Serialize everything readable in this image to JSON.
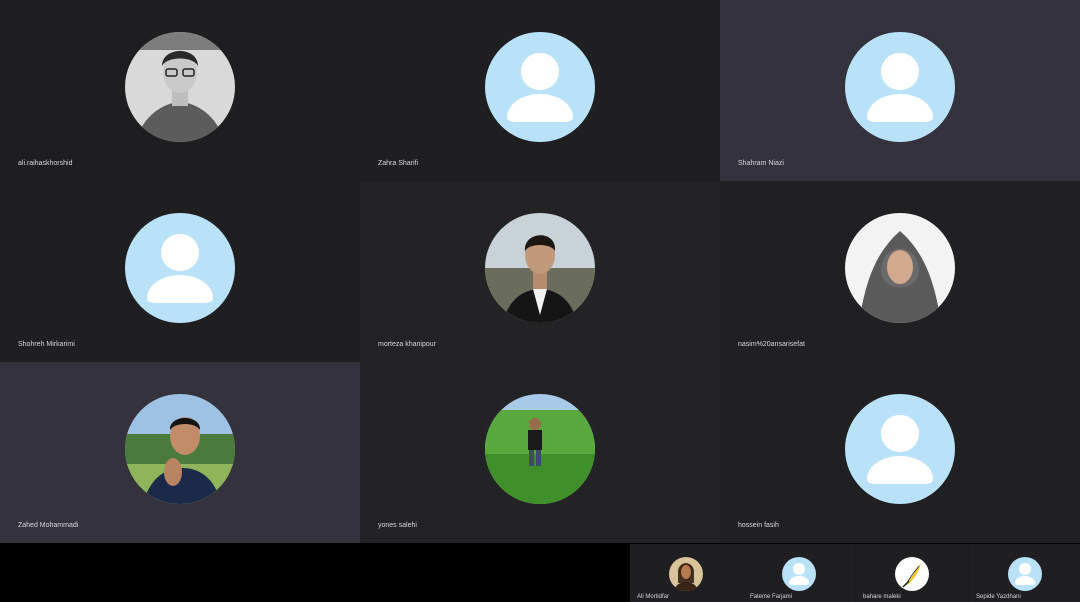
{
  "participants": [
    {
      "name": "ali.raihaskhorshid",
      "tile_color": "#1e1e21",
      "avatar": "photo-young-man-glasses"
    },
    {
      "name": "Zahra Sharifi",
      "tile_color": "#1f1f22",
      "avatar": "default-user-icon"
    },
    {
      "name": "Shahram Niazi",
      "tile_color": "#34333d",
      "avatar": "default-user-icon"
    },
    {
      "name": "Shohreh Mirkarimi",
      "tile_color": "#1f1f22",
      "avatar": "default-user-icon"
    },
    {
      "name": "morteza khanipour",
      "tile_color": "#232326",
      "avatar": "photo-man-suit"
    },
    {
      "name": "nasim%20ansarisefat",
      "tile_color": "#202023",
      "avatar": "photo-woman-hijab"
    },
    {
      "name": "Zahed Mohammadi",
      "tile_color": "#34333d",
      "avatar": "photo-man-outdoors"
    },
    {
      "name": "yones salehi",
      "tile_color": "#232326",
      "avatar": "photo-man-field"
    },
    {
      "name": "hossein fasih",
      "tile_color": "#202023",
      "avatar": "default-user-icon"
    }
  ],
  "strip_participants": [
    {
      "name": "Ali Mortidfar",
      "avatar": "photo-man-long-hair"
    },
    {
      "name": "Fateme Farjami",
      "avatar": "default-user-icon"
    },
    {
      "name": "bahare maleki",
      "avatar": "photo-feather-logo"
    },
    {
      "name": "Sepide Yazdhani",
      "avatar": "default-user-icon"
    }
  ],
  "colors": {
    "placeholder_bg": "#b9e1f8",
    "placeholder_fg": "#ffffff",
    "name_text": "#d8d8d8"
  }
}
